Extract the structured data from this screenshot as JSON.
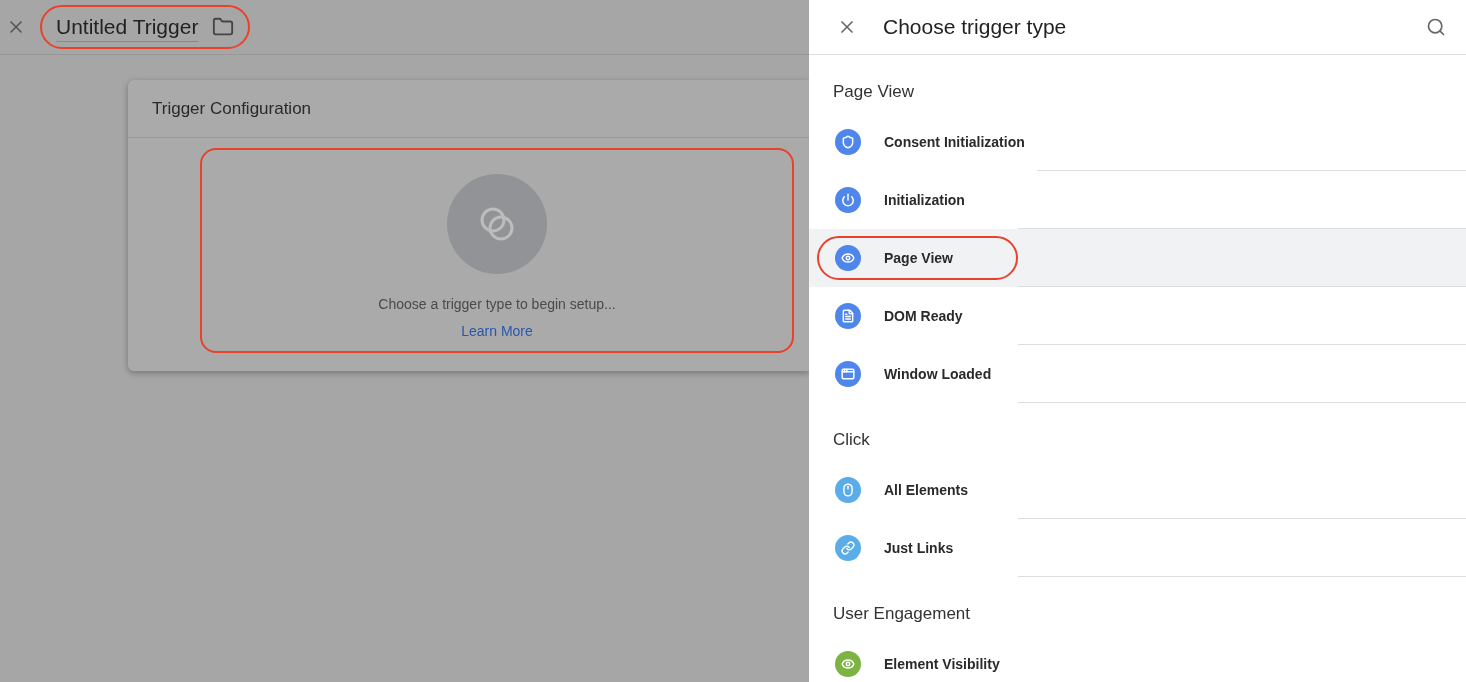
{
  "header": {
    "title": "Untitled Trigger",
    "circled": true
  },
  "config_card": {
    "title": "Trigger Configuration",
    "empty_text": "Choose a trigger type to begin setup...",
    "link": "Learn More",
    "circled": true
  },
  "panel": {
    "title": "Choose trigger type",
    "sections": [
      {
        "heading": "Page View",
        "items": [
          {
            "label": "Consent Initialization",
            "color": "#4f86ec",
            "selected": false,
            "circled": false
          },
          {
            "label": "Initialization",
            "color": "#4f86ec",
            "selected": false,
            "circled": false
          },
          {
            "label": "Page View",
            "color": "#4f86ec",
            "selected": true,
            "circled": true
          },
          {
            "label": "DOM Ready",
            "color": "#4f86ec",
            "selected": false,
            "circled": false
          },
          {
            "label": "Window Loaded",
            "color": "#4f86ec",
            "selected": false,
            "circled": false
          }
        ]
      },
      {
        "heading": "Click",
        "items": [
          {
            "label": "All Elements",
            "color": "#5aade8",
            "selected": false,
            "circled": false
          },
          {
            "label": "Just Links",
            "color": "#5aade8",
            "selected": false,
            "circled": false
          }
        ]
      },
      {
        "heading": "User Engagement",
        "items": [
          {
            "label": "Element Visibility",
            "color": "#7cb342",
            "selected": false,
            "circled": false
          }
        ]
      }
    ]
  }
}
